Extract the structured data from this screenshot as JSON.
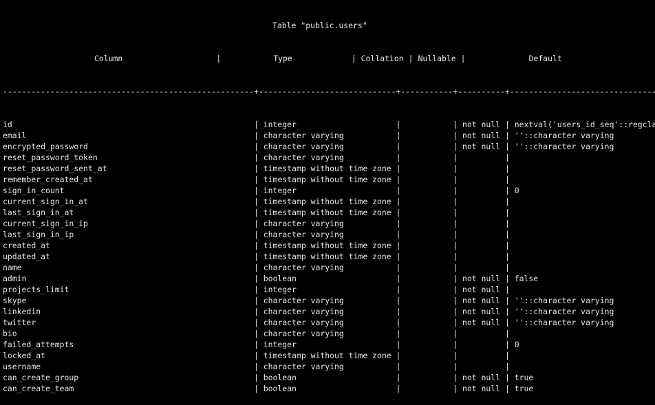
{
  "table_title": "Table \"public.users\"",
  "header_line": "                                    Column              |            Type             | Collation | Nullable |               Default",
  "separator_line": "-------------------------------------------------------+-----------------------------+-----------+----------+------------------------------",
  "columns": {
    "column": "Column",
    "type": "Type",
    "collation": "Collation",
    "nullable": "Nullable",
    "default": "Default"
  },
  "rows": [
    {
      "column": "id",
      "type": "integer",
      "collation": "",
      "nullable": "not null",
      "default": "nextval('users_id_seq'::regclass)"
    },
    {
      "column": "email",
      "type": "character varying",
      "collation": "",
      "nullable": "not null",
      "default": "''::character varying"
    },
    {
      "column": "encrypted_password",
      "type": "character varying",
      "collation": "",
      "nullable": "not null",
      "default": "''::character varying"
    },
    {
      "column": "reset_password_token",
      "type": "character varying",
      "collation": "",
      "nullable": "",
      "default": ""
    },
    {
      "column": "reset_password_sent_at",
      "type": "timestamp without time zone",
      "collation": "",
      "nullable": "",
      "default": ""
    },
    {
      "column": "remember_created_at",
      "type": "timestamp without time zone",
      "collation": "",
      "nullable": "",
      "default": ""
    },
    {
      "column": "sign_in_count",
      "type": "integer",
      "collation": "",
      "nullable": "",
      "default": "0"
    },
    {
      "column": "current_sign_in_at",
      "type": "timestamp without time zone",
      "collation": "",
      "nullable": "",
      "default": ""
    },
    {
      "column": "last_sign_in_at",
      "type": "timestamp without time zone",
      "collation": "",
      "nullable": "",
      "default": ""
    },
    {
      "column": "current_sign_in_ip",
      "type": "character varying",
      "collation": "",
      "nullable": "",
      "default": ""
    },
    {
      "column": "last_sign_in_ip",
      "type": "character varying",
      "collation": "",
      "nullable": "",
      "default": ""
    },
    {
      "column": "created_at",
      "type": "timestamp without time zone",
      "collation": "",
      "nullable": "",
      "default": ""
    },
    {
      "column": "updated_at",
      "type": "timestamp without time zone",
      "collation": "",
      "nullable": "",
      "default": ""
    },
    {
      "column": "name",
      "type": "character varying",
      "collation": "",
      "nullable": "",
      "default": ""
    },
    {
      "column": "admin",
      "type": "boolean",
      "collation": "",
      "nullable": "not null",
      "default": "false"
    },
    {
      "column": "projects_limit",
      "type": "integer",
      "collation": "",
      "nullable": "not null",
      "default": ""
    },
    {
      "column": "skype",
      "type": "character varying",
      "collation": "",
      "nullable": "not null",
      "default": "''::character varying"
    },
    {
      "column": "linkedin",
      "type": "character varying",
      "collation": "",
      "nullable": "not null",
      "default": "''::character varying"
    },
    {
      "column": "twitter",
      "type": "character varying",
      "collation": "",
      "nullable": "not null",
      "default": "''::character varying"
    },
    {
      "column": "bio",
      "type": "character varying",
      "collation": "",
      "nullable": "",
      "default": ""
    },
    {
      "column": "failed_attempts",
      "type": "integer",
      "collation": "",
      "nullable": "",
      "default": "0"
    },
    {
      "column": "locked_at",
      "type": "timestamp without time zone",
      "collation": "",
      "nullable": "",
      "default": ""
    },
    {
      "column": "username",
      "type": "character varying",
      "collation": "",
      "nullable": "",
      "default": ""
    },
    {
      "column": "can_create_group",
      "type": "boolean",
      "collation": "",
      "nullable": "not null",
      "default": "true"
    },
    {
      "column": "can_create_team",
      "type": "boolean",
      "collation": "",
      "nullable": "not null",
      "default": "true"
    }
  ],
  "colors": {
    "background": "#000000",
    "text": "#e6e6e6"
  }
}
